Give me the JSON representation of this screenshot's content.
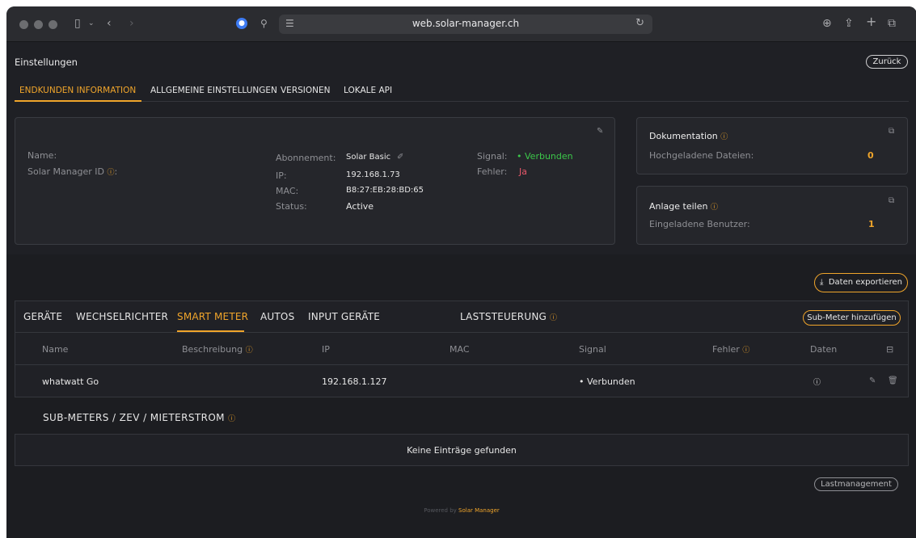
{
  "browser": {
    "url": "web.solar-manager.ch"
  },
  "page": {
    "title": "Einstellungen",
    "back_label": "Zurück"
  },
  "top_tabs": [
    {
      "label": "ENDKUNDEN INFORMATION",
      "active": true
    },
    {
      "label": "ALLGEMEINE EINSTELLUNGEN",
      "active": false
    },
    {
      "label": "VERSIONEN",
      "active": false
    },
    {
      "label": "LOKALE API",
      "active": false
    }
  ],
  "customer": {
    "name_label": "Name:",
    "id_label": "Solar Manager ID",
    "id_suffix": ":",
    "abo_label": "Abonnement:",
    "abo_value": "Solar Basic",
    "ip_label": "IP:",
    "ip_value": "192.168.1.73",
    "mac_label": "MAC:",
    "mac_value": "B8:27:EB:28:BD:65",
    "status_label": "Status:",
    "status_value": "Active",
    "signal_label": "Signal:",
    "signal_value": "Verbunden",
    "error_label": "Fehler:",
    "error_value": "Ja"
  },
  "documentation": {
    "title": "Dokumentation",
    "files_label": "Hochgeladene Dateien:",
    "files_count": "0"
  },
  "share": {
    "title": "Anlage teilen",
    "users_label": "Eingeladene Benutzer:",
    "users_count": "1"
  },
  "export_label": "Daten exportieren",
  "device_tabs": [
    {
      "label": "GERÄTE",
      "active": false
    },
    {
      "label": "WECHSELRICHTER",
      "active": false
    },
    {
      "label": "SMART METER",
      "active": true
    },
    {
      "label": "AUTOS",
      "active": false
    },
    {
      "label": "INPUT GERÄTE",
      "active": false
    },
    {
      "label": "LASTSTEUERUNG",
      "active": false
    }
  ],
  "add_submeter_label": "Sub-Meter hinzufügen",
  "table": {
    "columns": [
      "Name",
      "Beschreibung",
      "IP",
      "MAC",
      "Signal",
      "Fehler",
      "Daten"
    ],
    "rows": [
      {
        "name": "whatwatt Go",
        "description": "",
        "ip": "192.168.1.127",
        "mac": "",
        "signal": "Verbunden"
      }
    ]
  },
  "submeters": {
    "title": "SUB-METERS / ZEV / MIETERSTROM",
    "empty_text": "Keine Einträge gefunden"
  },
  "load_mgmt_label": "Lastmanagement",
  "footer": {
    "powered_by": "Powered by",
    "brand": "Solar Manager"
  },
  "colors": {
    "accent": "#f0a52b",
    "connected": "#3cc84a",
    "error": "#e8586a"
  }
}
